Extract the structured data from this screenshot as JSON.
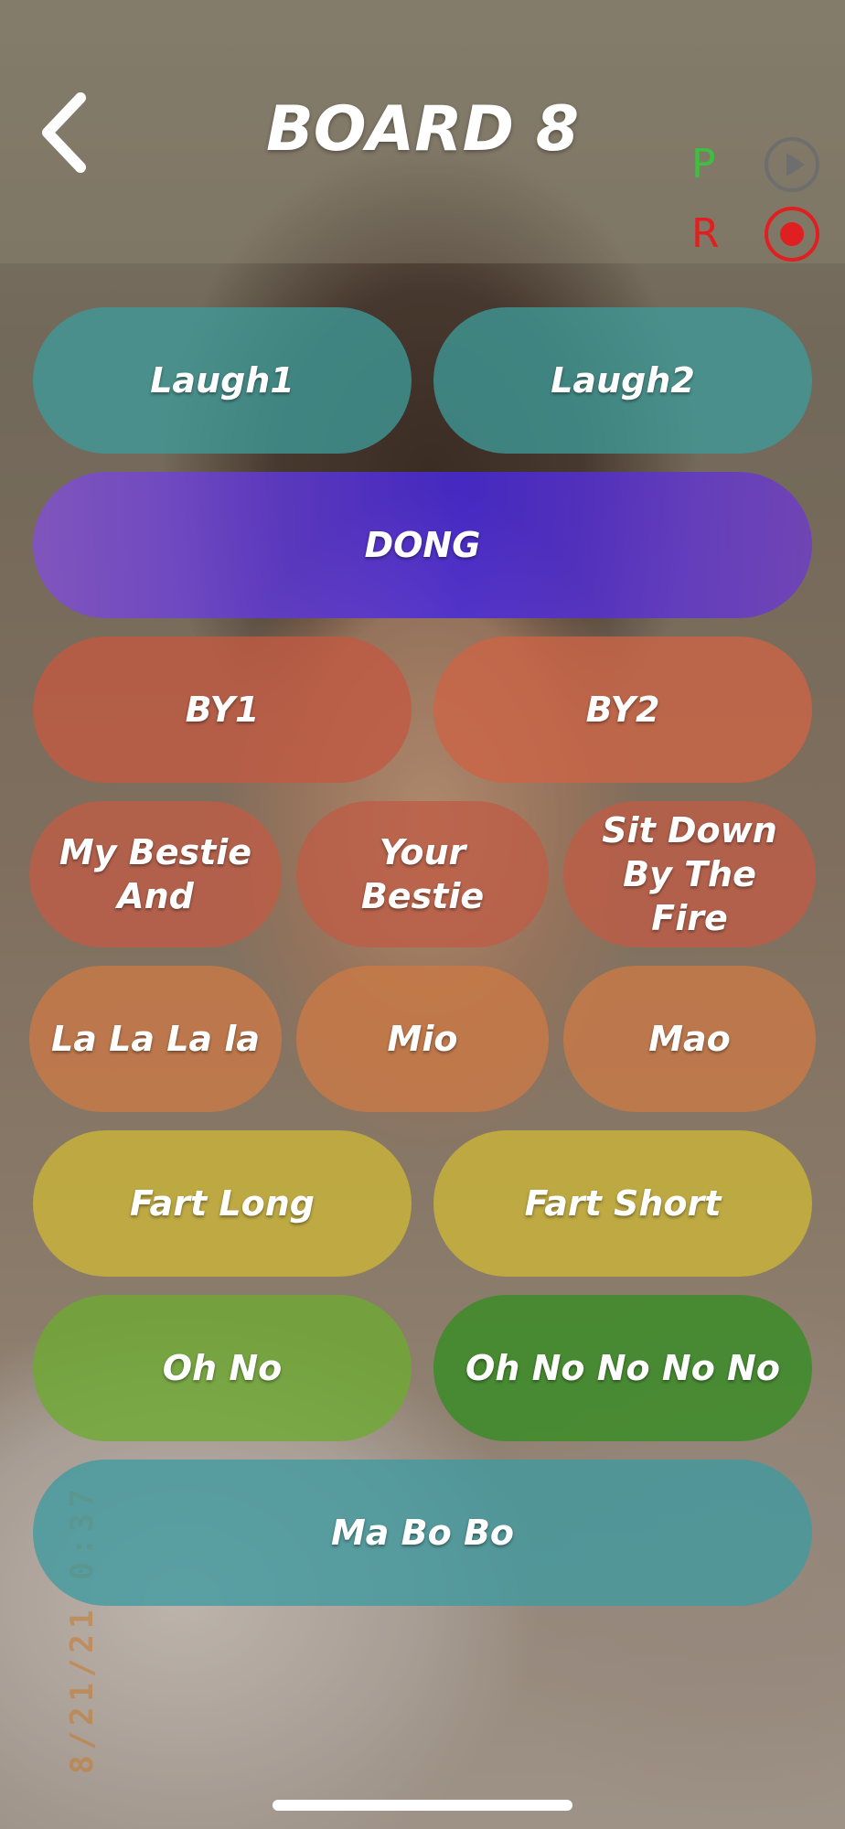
{
  "header": {
    "title": "BOARD 8"
  },
  "controls": {
    "play_label": "P",
    "record_label": "R"
  },
  "background": {
    "date_stamp": "8/21/21 0:37"
  },
  "buttons": {
    "laugh1": "Laugh1",
    "laugh2": "Laugh2",
    "dong": "DONG",
    "by1": "BY1",
    "by2": "BY2",
    "my_bestie_and": "My Bestie And",
    "your_bestie": "Your Bestie",
    "sit_down": "Sit Down By The Fire",
    "lalala": "La La La la",
    "mio": "Mio",
    "mao": "Mao",
    "fart_long": "Fart Long",
    "fart_short": "Fart Short",
    "oh_no": "Oh No",
    "oh_no_no": "Oh No No No No",
    "ma_bo_bo": "Ma Bo Bo"
  },
  "colors": {
    "teal": "#3f9a98",
    "purple": "#6a3fd0",
    "red": "#c25a42",
    "orange": "#cc7a45",
    "yellow": "#c9b33a",
    "green": "#4f9e2f",
    "record_red": "#e02020",
    "play_green": "#3fbf3f"
  }
}
